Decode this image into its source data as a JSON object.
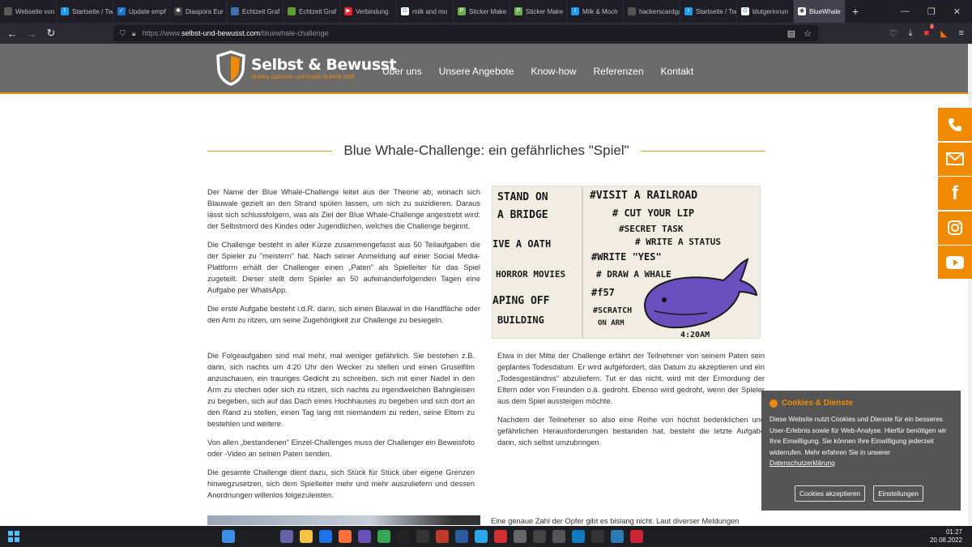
{
  "browser": {
    "tabs": [
      {
        "label": "Webseite von Me",
        "icon": "page-icon",
        "color": "#5a5a5a",
        "glyph": ""
      },
      {
        "label": "Startseite / Tw",
        "icon": "twitter-icon",
        "color": "#1d9bf0",
        "glyph": "t"
      },
      {
        "label": "Update empf",
        "icon": "shield-check-icon",
        "color": "#1976d2",
        "glyph": "✓"
      },
      {
        "label": "Diaspora Eur",
        "icon": "diaspora-icon",
        "color": "#444",
        "glyph": "✱"
      },
      {
        "label": "Echtzeit Graf",
        "icon": "document-icon",
        "color": "#3a6fb0",
        "glyph": ""
      },
      {
        "label": "Echtzeit Graf",
        "icon": "frog-icon",
        "color": "#5aa02c",
        "glyph": ""
      },
      {
        "label": "Verbindung",
        "icon": "youtube-icon",
        "color": "#e22",
        "glyph": "▶"
      },
      {
        "label": "milk and mo",
        "icon": "google-icon",
        "color": "#fff",
        "glyph": "G"
      },
      {
        "label": "Sticker Make",
        "icon": "sticker-icon",
        "color": "#6ab04c",
        "glyph": "P"
      },
      {
        "label": "Sticker Make",
        "icon": "sticker-icon",
        "color": "#6ab04c",
        "glyph": "P"
      },
      {
        "label": "Milk & Moch",
        "icon": "twitter-icon",
        "color": "#1d9bf0",
        "glyph": "t"
      },
      {
        "label": "hackerscardgame",
        "icon": "page-icon",
        "color": "#555",
        "glyph": ""
      },
      {
        "label": "Startseite / Tw",
        "icon": "twitter-icon",
        "color": "#1d9bf0",
        "glyph": "t"
      },
      {
        "label": "blutgerinnun",
        "icon": "google-icon",
        "color": "#fff",
        "glyph": "G"
      }
    ],
    "active_tab": "BlueWhale",
    "url_scheme": "https://www.",
    "url_domain": "selbst-und-bewusst.com",
    "url_path": "/bluewhale-challenge",
    "notification_count": "2"
  },
  "site": {
    "brand": "Selbst & Bewusst",
    "brand_sub": "Andrea Salomon und Guido Schenk GbR",
    "nav": [
      "Über uns",
      "Unsere Angebote",
      "Know-how",
      "Referenzen",
      "Kontakt"
    ],
    "accent": "#f08a00",
    "header_bg": "#6b6b6b"
  },
  "article": {
    "title": "Blue Whale-Challenge: ein gefährliches \"Spiel\"",
    "left_top": [
      "Der Name der Blue Whale-Challenge leitet aus der Theorie ab, wonach sich Blauwale gezielt an den Strand spülen lassen, um sich zu suizidieren. Daraus lässt sich schlussfolgern, was als Ziel der Blue Whale-Challenge angestrebt wird: der Selbstmord des Kindes oder Jugendlichen, welches die Challenge beginnt.",
      "Die Challenge besteht in aller Kürze zusammengefasst aus 50 Teilaufgaben die der Spieler zu \"meistern\" hat. Nach seiner Anmeldung auf einer Social Media-Plattform erhält der Challenger einen „Paten\" als Spielleiter für das Spiel zugeteilt. Dieser stellt dem Spieler an 50 aufeinanderfolgenden Tagen eine Aufgabe per WhatsApp.",
      "Die erste Aufgabe besteht i.d.R. darin, sich einen Blauwal in die Handfläche oder den Arm zu ritzen, um seine Zugehörigkeit zur Challenge zu besiegeln."
    ],
    "left_bottom": [
      "Die Folgeaufgaben sind mal mehr, mal weniger gefährlich. Sie bestehen z.B. darin, sich nachts um 4:20 Uhr den Wecker zu stellen und einen Gruselfilm anzuschauen, ein trauriges Gedicht zu schreiben, sich mit einer Nadel in den Arm zu stechen oder sich zu ritzen, sich nachts zu irgendwelchen Bahngleisen zu begeben, sich auf das Dach eines Hochhauses zu begeben und sich dort an den Rand zu stellen, einen Tag lang mit niemandem zu reden, seine Eltern zu bestehlen und weitere.",
      "Von allen „bestandenen\" Einzel-Challenges muss der Challenger ein Beweisfoto oder -Video an seinen Paten senden.",
      "Die gesamte Challenge dient dazu, sich Stück für Stück über eigene Grenzen hinwegzusetzen, sich dem Spielleiter mehr und mehr auszuliefern und dessen Anordnungen willenlos folgezuleisten."
    ],
    "right": [
      "Etwa in der Mitte der Challenge erfährt der Teilnehmer von seinem Paten sein geplantes Todesdatum. Er wird aufgefordert, das Datum zu akzeptieren und ein „Todesgeständnis\" abzuliefern. Tut er das nicht, wird mit der Ermordung der Eltern oder von Freunden o.ä. gedroht. Ebenso wird gedroht, wenn der Spieler aus dem Spiel aussteigen möchte.",
      "Nachdem der Teilnehmer so also eine Reihe von höchst bedenklichen und gefährlichen Herausforderungen bestanden hat, besteht die letzte Aufgabe darin, sich selbst umzubringen."
    ],
    "right_cut": "Eine genaue Zahl der Opfer gibt es bislang nicht. Laut diverser Meldungen",
    "image_text": {
      "left_lines": [
        "STAND ON",
        "A BRIDGE",
        "IVE A OATH",
        "HORROR MOVIES",
        "APING OFF",
        "BUILDING"
      ],
      "right_lines": [
        "#VISIT A RAILROAD",
        "# CUT YOUR LIP",
        "#SECRET TASK",
        "# WRITE A STATUS",
        "#WRITE \"YES\"",
        "# DRAW A WHALE",
        "#f57",
        "#SCRATCH",
        "ON ARM",
        "4:20AM"
      ]
    }
  },
  "cookie": {
    "title": "Cookies & Dienste",
    "text": "Diese Website nutzt Cookies und Dienste für ein besseres User-Erlebnis sowie für Web-Analyse. Hierfür benötigen wir Ihre Einwilligung. Sie können Ihre Einwilligung jederzeit widerrufen. Mehr erfahren Sie in unserer",
    "link": "Datenschutzerklärung",
    "accept": "Cookies akzeptieren",
    "settings": "Einstellungen"
  },
  "taskbar": {
    "time": "01:27",
    "date": "20.08.2022",
    "icons": [
      {
        "name": "windows-icon",
        "color": "#3a8ee6"
      },
      {
        "name": "search-icon",
        "color": "#1d1e22"
      },
      {
        "name": "task-view-icon",
        "color": "#1d1e22"
      },
      {
        "name": "teams-icon",
        "color": "#6264a7"
      },
      {
        "name": "folder-icon",
        "color": "#f5c242"
      },
      {
        "name": "defender-icon",
        "color": "#1a73e8"
      },
      {
        "name": "firefox-icon",
        "color": "#ff7139"
      },
      {
        "name": "firefox-dev-icon",
        "color": "#6b4fbb"
      },
      {
        "name": "chrome-icon",
        "color": "#34a853"
      },
      {
        "name": "live-icon",
        "color": "#222"
      },
      {
        "name": "obs-icon",
        "color": "#333"
      },
      {
        "name": "app-red-icon",
        "color": "#c0392b"
      },
      {
        "name": "powershell-icon",
        "color": "#2c5aa0"
      },
      {
        "name": "telegram-icon",
        "color": "#29a9eb"
      },
      {
        "name": "hidden-icon",
        "color": "#d32f2f"
      },
      {
        "name": "photo-icon",
        "color": "#666"
      },
      {
        "name": "monitor-icon",
        "color": "#444"
      },
      {
        "name": "bars-icon",
        "color": "#555"
      },
      {
        "name": "edge-icon",
        "color": "#0f7ac0"
      },
      {
        "name": "inkscape-icon",
        "color": "#333"
      },
      {
        "name": "image-viewer-icon",
        "color": "#2a7ab8"
      },
      {
        "name": "snip-icon",
        "color": "#c23"
      }
    ]
  }
}
